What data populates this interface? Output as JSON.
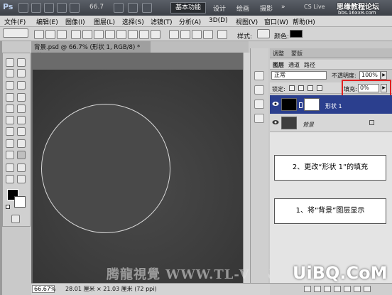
{
  "app": {
    "logo": "Ps",
    "zoom": "66.7",
    "workspace_active": "基本功能",
    "workspaces": [
      "设计",
      "绘画",
      "摄影"
    ],
    "cslive": "CS Live",
    "watermark_top": "思缘教程论坛",
    "watermark_url": "bbs.16xx8.com"
  },
  "menu": [
    "文件(F)",
    "编辑(E)",
    "图像(I)",
    "图层(L)",
    "选择(S)",
    "滤镜(T)",
    "分析(A)",
    "3D(D)",
    "视图(V)",
    "窗口(W)",
    "帮助(H)"
  ],
  "options": {
    "style_label": "样式:",
    "color_label": "颜色:"
  },
  "document": {
    "tab_title": "背景.psd @ 66.7% (形状 1, RGB/8) *",
    "close": "×"
  },
  "panels": {
    "top_tabs": [
      "调整",
      "蒙版"
    ],
    "layer_tabs": [
      "图层",
      "通道",
      "路径"
    ],
    "blend_mode": "正常",
    "opacity_label": "不透明度:",
    "opacity_value": "100%",
    "lock_label": "锁定:",
    "fill_label": "填充:",
    "fill_value": "0%",
    "layers": [
      {
        "name": "形状 1",
        "selected": true
      },
      {
        "name": "背景",
        "selected": false
      }
    ]
  },
  "notes": {
    "note2": "2、更改“形状 1”的填充",
    "note1": "1、将“背景”图层显示"
  },
  "status": {
    "zoom": "66.67%",
    "info": "28.01 厘米 × 21.03 厘米 (72 ppi)"
  },
  "watermarks": {
    "bottom": "腾龍視覺 WWW.TL-VI.NET",
    "uibq": "UiBQ.CoM"
  },
  "colors": {
    "selected_layer": "#2b3f8e",
    "highlight_frame": "#e02020"
  }
}
